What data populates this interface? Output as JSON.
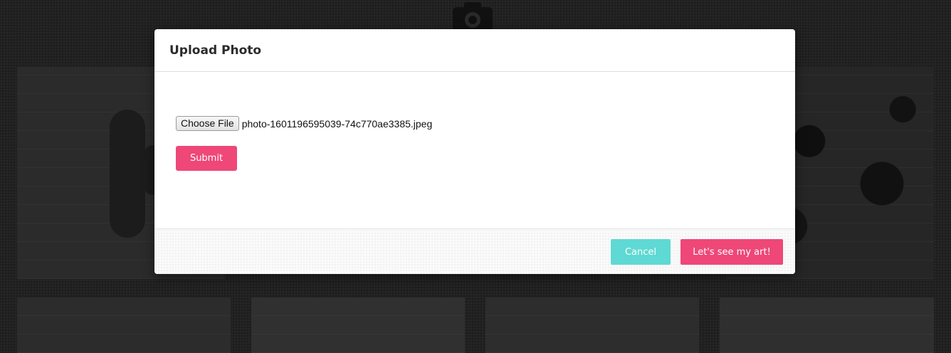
{
  "modal": {
    "title": "Upload Photo",
    "choose_file_label": "Choose File",
    "file_name": "photo-1601196595039-74c770ae3385.jpeg",
    "submit_label": "Submit",
    "cancel_label": "Cancel",
    "confirm_label": "Let's see my art!"
  },
  "icons": {
    "header_icon": "camera-icon"
  },
  "colors": {
    "primary_pink": "#ee4778",
    "cancel_teal": "#5fd9d3",
    "overlay_background": "#1f1f1f"
  }
}
